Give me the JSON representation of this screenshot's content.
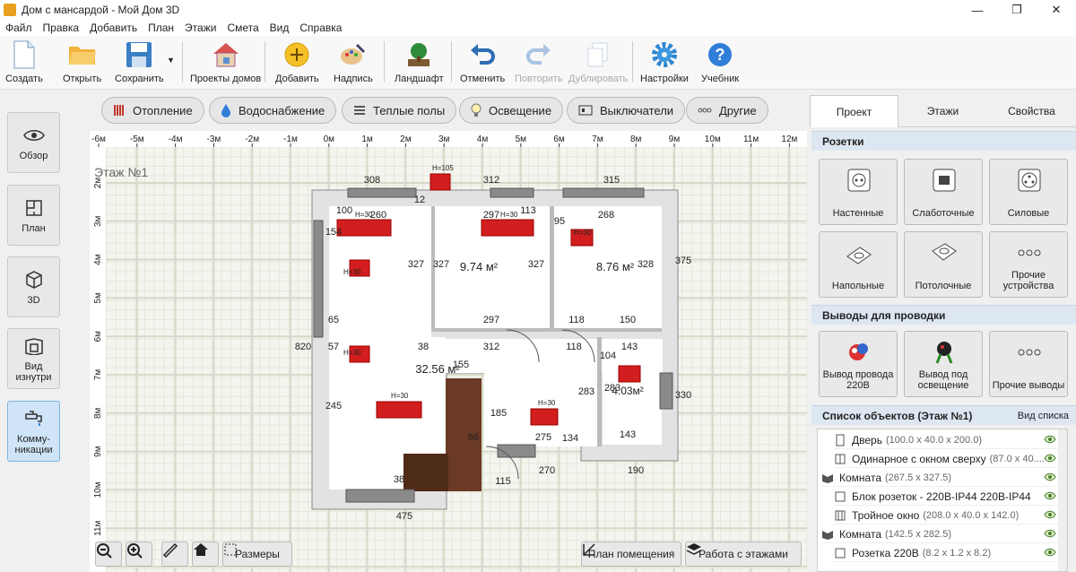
{
  "window": {
    "title": "Дом с мансардой - Мой Дом 3D",
    "minimize": "—",
    "maximize": "❐",
    "close": "✕"
  },
  "menu": [
    "Файл",
    "Правка",
    "Добавить",
    "План",
    "Этажи",
    "Смета",
    "Вид",
    "Справка"
  ],
  "toolbar": {
    "create": "Создать",
    "open": "Открыть",
    "save": "Сохранить",
    "projects": "Проекты домов",
    "add": "Добавить",
    "label": "Надпись",
    "landscape": "Ландшафт",
    "undo": "Отменить",
    "redo": "Повторить",
    "duplicate": "Дублировать",
    "settings": "Настройки",
    "tutorial": "Учебник"
  },
  "sidebar": {
    "overview": "Обзор",
    "plan": "План",
    "view3d": "3D",
    "inside": "Вид изнутри",
    "comm": "Комму-никации"
  },
  "filters": {
    "heating": "Отопление",
    "water": "Водоснабжение",
    "floors": "Теплые полы",
    "light": "Освещение",
    "switches": "Выключатели",
    "other": "Другие"
  },
  "canvas": {
    "floor_label": "Этаж №1",
    "ruler_h": [
      "-6м",
      "-5м",
      "-4м",
      "-3м",
      "-2м",
      "-1м",
      "0м",
      "1м",
      "2м",
      "3м",
      "4м",
      "5м",
      "6м",
      "7м",
      "8м",
      "9м",
      "10м",
      "11м",
      "12м"
    ],
    "ruler_v": [
      "2м",
      "3м",
      "4м",
      "5м",
      "6м",
      "7м",
      "8м",
      "9м",
      "10м",
      "11м"
    ],
    "rooms": {
      "r1": "9.74 м²",
      "r2": "8.76 м²",
      "r3": "32.56 м²",
      "r4": "4.03м²"
    },
    "dims": [
      "308",
      "312",
      "315",
      "260",
      "297",
      "268",
      "100",
      "12",
      "113",
      "95",
      "154",
      "327",
      "327",
      "327",
      "328",
      "375",
      "297",
      "118",
      "150",
      "65",
      "38",
      "312",
      "118",
      "143",
      "820",
      "57",
      "155",
      "104",
      "283",
      "283",
      "330",
      "245",
      "66",
      "185",
      "275",
      "134",
      "143",
      "270",
      "190",
      "38",
      "115",
      "475"
    ],
    "socket_h": "H=30",
    "socket_h105": "H=105"
  },
  "canvas_buttons": {
    "zoom_out": "−",
    "zoom_in": "+",
    "dimensions": "Размеры",
    "room_plan": "План помещения",
    "floors_work": "Работа с этажами"
  },
  "right_panel": {
    "tabs": [
      "Проект",
      "Этажи",
      "Свойства"
    ],
    "sockets_header": "Розетки",
    "sockets": [
      "Настенные",
      "Слаботочные",
      "Силовые",
      "Напольные",
      "Потолочные",
      "Прочие устройства"
    ],
    "wiring_header": "Выводы для проводки",
    "wiring": [
      "Вывод провода 220В",
      "Вывод под освещение",
      "Прочие выводы"
    ],
    "list_header": "Список объектов (Этаж №1)",
    "list_view": "Вид списка",
    "objects": [
      {
        "name": "Дверь",
        "dim": "(100.0 x 40.0 x 200.0)"
      },
      {
        "name": "Одинарное с окном сверху",
        "dim": "(87.0 x 40...."
      },
      {
        "name": "Комната",
        "dim": "(267.5 x 327.5)"
      },
      {
        "name": "Блок розеток - 220В-IP44 220В-IP44",
        "dim": ""
      },
      {
        "name": "Тройное окно",
        "dim": "(208.0 x 40.0 x 142.0)"
      },
      {
        "name": "Комната",
        "dim": "(142.5 x 282.5)"
      },
      {
        "name": "Розетка 220В",
        "dim": "(8.2 x 1.2 x 8.2)"
      }
    ]
  }
}
